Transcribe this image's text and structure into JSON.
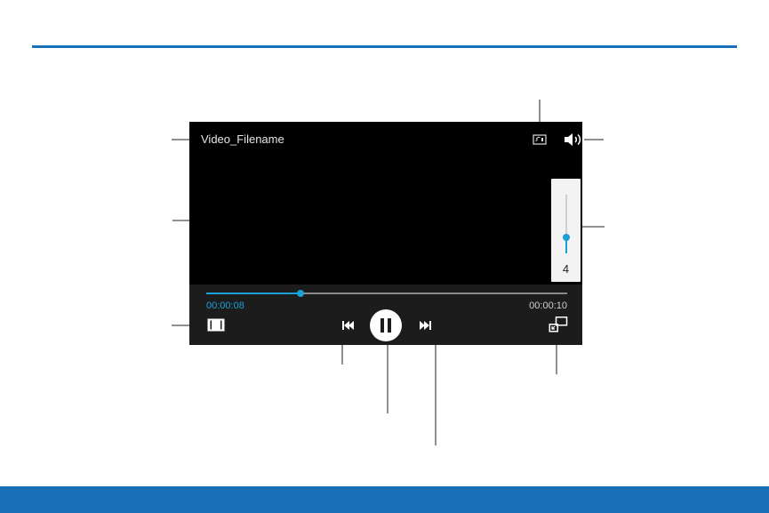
{
  "colors": {
    "accent": "#1a70b8",
    "progress": "#1aa0d8",
    "player_background": "#000000",
    "control_bar": "#1c1c1c"
  },
  "player": {
    "title": "Video_Filename",
    "elapsed_time": "00:00:08",
    "total_time": "00:00:10",
    "progress_fraction": 0.26,
    "volume_level": "4",
    "volume_fraction": 0.27
  },
  "icons": {
    "cast": "screen-mirroring-icon",
    "volume": "speaker-icon",
    "ratio": "aspect-ratio-icon",
    "previous": "skip-previous-icon",
    "play_pause": "pause-icon",
    "next": "skip-next-icon",
    "popup": "popup-player-icon"
  }
}
